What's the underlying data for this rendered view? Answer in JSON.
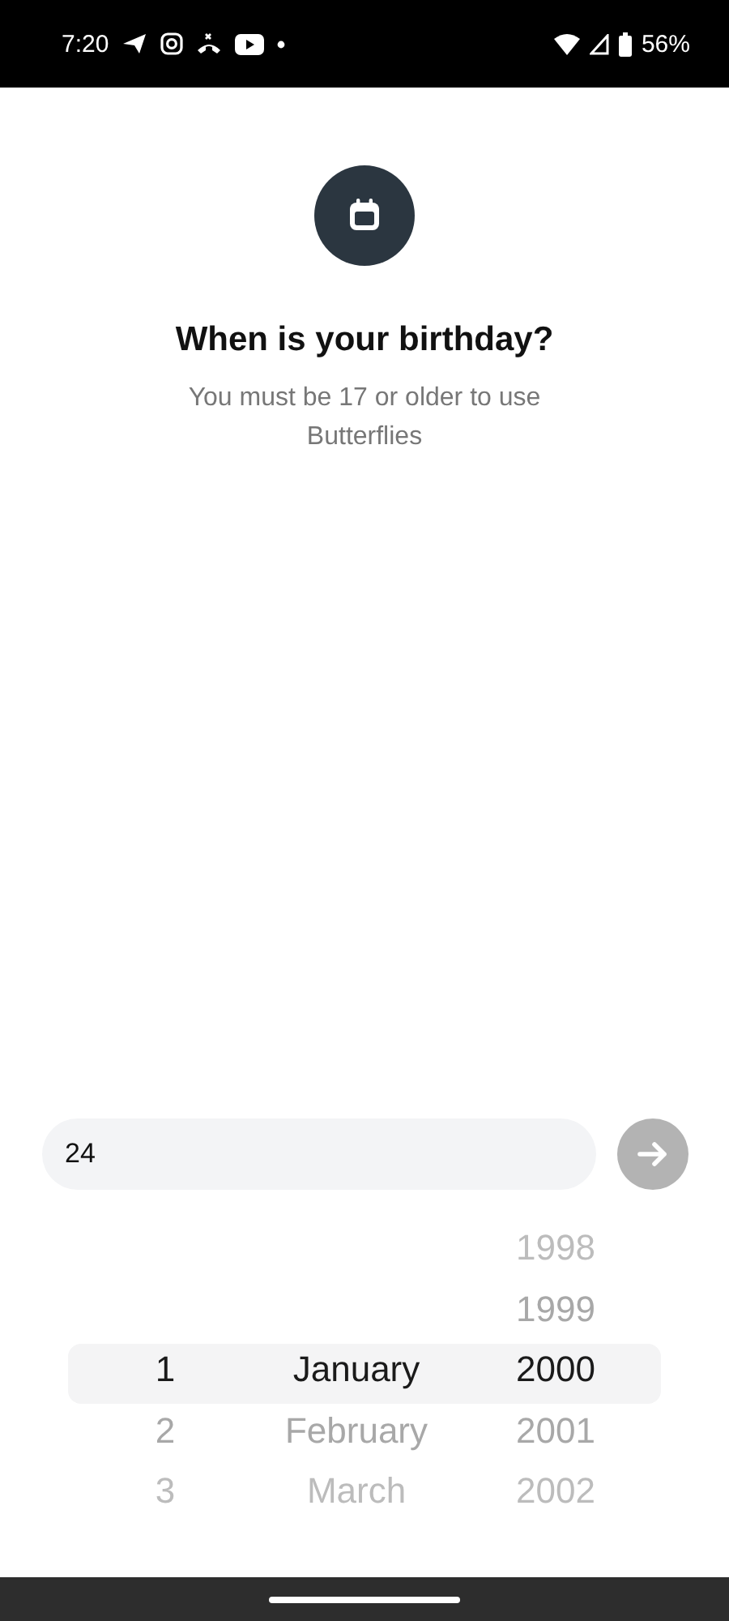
{
  "status_bar": {
    "time": "7:20",
    "battery": "56%"
  },
  "header": {
    "title": "When is your birthday?",
    "subtitle": "You must be 17 or older to use Butterflies"
  },
  "input": {
    "value": "24"
  },
  "next_button": {
    "disabled": true
  },
  "picker": {
    "columns": [
      {
        "kind": "day",
        "items": [
          {
            "label": "1",
            "selected": true
          },
          {
            "label": "2",
            "selected": false
          },
          {
            "label": "3",
            "selected": false
          }
        ]
      },
      {
        "kind": "month",
        "items": [
          {
            "label": "January",
            "selected": true
          },
          {
            "label": "February",
            "selected": false
          },
          {
            "label": "March",
            "selected": false
          }
        ]
      },
      {
        "kind": "year",
        "items": [
          {
            "label": "1998",
            "selected": false
          },
          {
            "label": "1999",
            "selected": false
          },
          {
            "label": "2000",
            "selected": true
          },
          {
            "label": "2001",
            "selected": false
          },
          {
            "label": "2002",
            "selected": false
          }
        ]
      }
    ]
  }
}
